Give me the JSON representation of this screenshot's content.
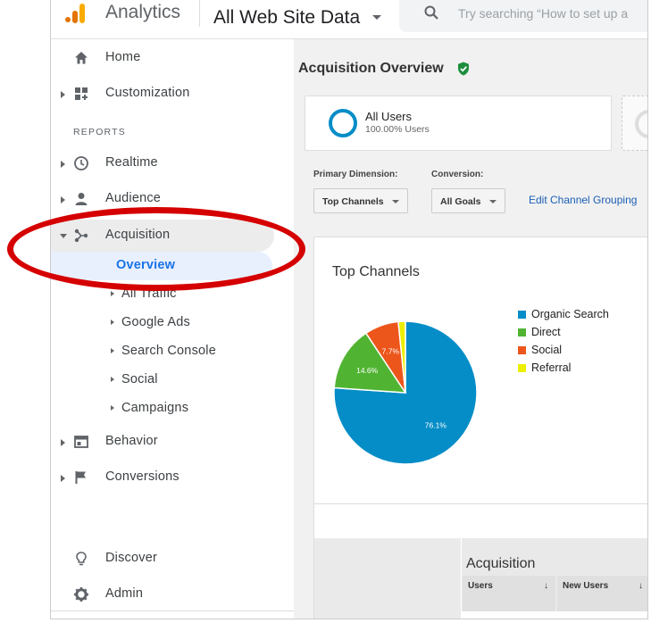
{
  "header": {
    "app_title": "Analytics",
    "property_title": "All Web Site Data",
    "search_placeholder": "Try searching “How to set up a"
  },
  "sidebar": {
    "items": [
      {
        "label": "Home",
        "icon": "home-icon"
      },
      {
        "label": "Customization",
        "icon": "dashboard-icon"
      },
      {
        "label": "Realtime",
        "icon": "clock-icon"
      },
      {
        "label": "Audience",
        "icon": "person-icon"
      },
      {
        "label": "Acquisition",
        "icon": "acquisition-icon"
      },
      {
        "label": "Behavior",
        "icon": "behavior-icon"
      },
      {
        "label": "Conversions",
        "icon": "flag-icon"
      },
      {
        "label": "Discover",
        "icon": "lightbulb-icon"
      },
      {
        "label": "Admin",
        "icon": "gear-icon"
      }
    ],
    "section_label": "REPORTS",
    "acquisition_children": [
      "Overview",
      "All Traffic",
      "Google Ads",
      "Search Console",
      "Social",
      "Campaigns"
    ]
  },
  "main": {
    "page_title": "Acquisition Overview",
    "segment": {
      "name": "All Users",
      "sub": "100.00% Users"
    },
    "primary_dimension_label": "Primary Dimension:",
    "conversion_label": "Conversion:",
    "primary_dimension_value": "Top Channels",
    "conversion_value": "All Goals",
    "edit_link": "Edit Channel Grouping",
    "table": {
      "group_header": "Acquisition",
      "columns": [
        "Users",
        "New Users"
      ],
      "sort_glyph": "↓"
    }
  },
  "colors": {
    "accent": "#1a73e8",
    "annotation_red": "#d50000",
    "organic": "#058dc7",
    "direct": "#50b432",
    "social": "#ed561b",
    "referral": "#edef00"
  },
  "chart_data": {
    "type": "pie",
    "title": "Top Channels",
    "categories": [
      "Organic Search",
      "Direct",
      "Social",
      "Referral"
    ],
    "values": [
      76.1,
      14.6,
      7.7,
      1.6
    ],
    "data_labels": [
      "76.1%",
      "14.6%",
      "7.7%",
      ""
    ],
    "colors": [
      "#058dc7",
      "#50b432",
      "#ed561b",
      "#edef00"
    ],
    "legend_position": "right"
  }
}
